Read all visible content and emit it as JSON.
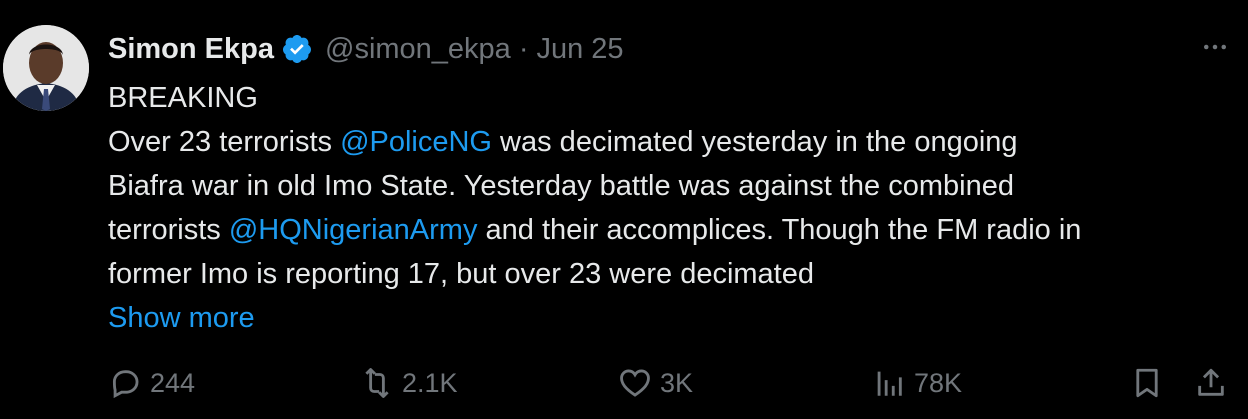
{
  "author": {
    "display_name": "Simon Ekpa",
    "handle": "@simon_ekpa",
    "separator": "·",
    "date": "Jun 25",
    "verified": true
  },
  "tweet": {
    "line1": "BREAKING",
    "line2_a": "Over 23 terrorists ",
    "mention1": "@PoliceNG",
    "line2_b": " was decimated yesterday in the ongoing",
    "line3": "Biafra war in old Imo State. Yesterday battle was against the combined",
    "line4_a": "terrorists ",
    "mention2": "@HQNigerianArmy",
    "line4_b": " and their accomplices. Though the FM radio in",
    "line5": "former Imo is reporting 17, but over 23 were decimated",
    "show_more": "Show more"
  },
  "actions": {
    "replies": "244",
    "reposts": "2.1K",
    "likes": "3K",
    "views": "78K"
  },
  "icons": {
    "more": "more-horizontal-icon",
    "verified": "verified-badge-icon",
    "reply": "reply-icon",
    "repost": "repost-icon",
    "like": "heart-icon",
    "views": "views-chart-icon",
    "bookmark": "bookmark-icon",
    "share": "share-icon"
  },
  "colors": {
    "background": "#000000",
    "text": "#e7e9ea",
    "muted": "#71767b",
    "link": "#1d9bf0"
  }
}
